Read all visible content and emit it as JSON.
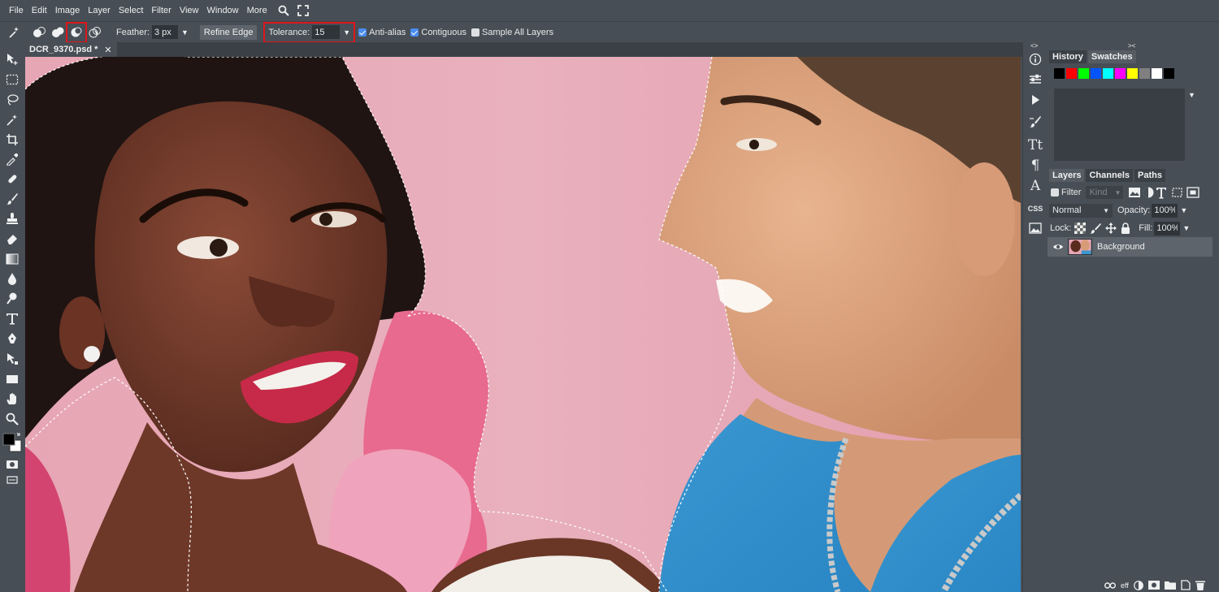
{
  "menu": [
    "File",
    "Edit",
    "Image",
    "Layer",
    "Select",
    "Filter",
    "View",
    "Window",
    "More"
  ],
  "menu_icons": [
    "search-icon",
    "fullscreen-icon"
  ],
  "options": {
    "tool_icon": "magic-wand-icon",
    "selection_modes": [
      "new-selection-icon",
      "add-selection-icon",
      "subtract-selection-icon",
      "intersect-selection-icon"
    ],
    "selected_mode_index": 2,
    "feather_label": "Feather:",
    "feather_value": "3 px",
    "refine_edge": "Refine Edge",
    "tolerance_label": "Tolerance:",
    "tolerance_value": "15",
    "anti_alias": "Anti-alias",
    "anti_alias_checked": true,
    "contiguous": "Contiguous",
    "contiguous_checked": true,
    "sample_all_layers": "Sample All Layers",
    "sample_all_layers_checked": false
  },
  "doc_tab": {
    "title": "DCR_9370.psd *",
    "close": "✕"
  },
  "tools": [
    "move-icon",
    "marquee-icon",
    "lasso-icon",
    "magic-wand-icon",
    "crop-icon",
    "eyedropper-icon",
    "healing-icon",
    "brush-icon",
    "stamp-icon",
    "eraser-icon",
    "gradient-icon",
    "blur-icon",
    "dodge-icon",
    "type-icon",
    "pen-icon",
    "path-select-icon",
    "shape-icon",
    "hand-icon",
    "zoom-icon",
    "color-swatches-icon",
    "quick-mask-icon",
    "screen-mode-icon"
  ],
  "right_strip": [
    "info-icon",
    "adjustments-icon",
    "actions-icon",
    "brush-settings-icon",
    "character-icon",
    "paragraph-icon",
    "glyphs-icon",
    "css-icon",
    "image-icon"
  ],
  "right_strip_css": "CSS",
  "history_panel": {
    "tabs": [
      "History",
      "Swatches"
    ],
    "active_tab": "Swatches",
    "swatch_colors": [
      "#000000",
      "#ff0000",
      "#00ff00",
      "#0055ff",
      "#00ffff",
      "#ff00ff",
      "#ffff00",
      "#808080",
      "#ffffff",
      "#000000"
    ]
  },
  "layers_panel": {
    "tabs": [
      "Layers",
      "Channels",
      "Paths"
    ],
    "filter_label": "Filter",
    "kind_label": "Kind",
    "blend_mode": "Normal",
    "opacity_label": "Opacity:",
    "opacity_value": "100%",
    "lock_label": "Lock:",
    "fill_label": "Fill:",
    "fill_value": "100%",
    "layers": [
      {
        "name": "Background",
        "visible": true
      }
    ],
    "bottom_icons": [
      "link-icon",
      "effects-icon",
      "adjustment-layer-icon",
      "mask-icon",
      "folder-icon",
      "new-layer-icon",
      "trash-icon"
    ],
    "effects_label": "eff"
  }
}
